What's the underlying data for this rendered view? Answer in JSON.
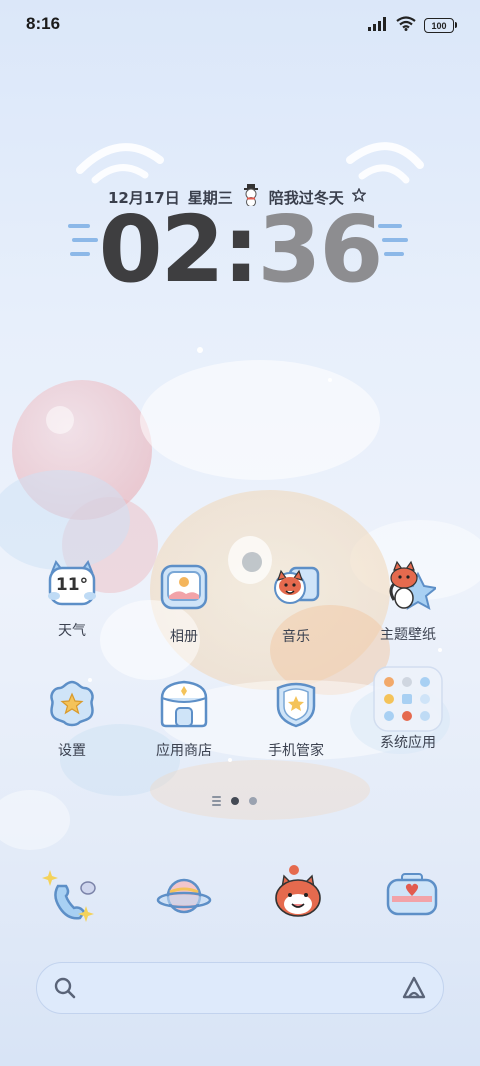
{
  "status_bar": {
    "time": "8:16",
    "signal_icon": "signal-bars-icon",
    "wifi_icon": "wifi-icon",
    "battery_level": "100"
  },
  "clock_widget": {
    "date": "12月17日",
    "weekday": "星期三",
    "slogan": "陪我过冬天",
    "hours": "02",
    "colon": ":",
    "minutes": "36"
  },
  "apps_row1": [
    {
      "label": "天气",
      "icon": "weather-cat-icon",
      "temp": "11°"
    },
    {
      "label": "相册",
      "icon": "gallery-icon"
    },
    {
      "label": "音乐",
      "icon": "music-icon"
    },
    {
      "label": "主题壁纸",
      "icon": "themes-icon"
    }
  ],
  "apps_row2": [
    {
      "label": "设置",
      "icon": "settings-flower-icon"
    },
    {
      "label": "应用商店",
      "icon": "app-store-icon"
    },
    {
      "label": "手机管家",
      "icon": "security-shield-icon"
    },
    {
      "label": "系统应用",
      "icon": "system-apps-folder-icon"
    }
  ],
  "page_indicator": {
    "pages": 2,
    "current": 1
  },
  "dock": [
    {
      "icon": "phone-icon"
    },
    {
      "icon": "messages-planet-icon"
    },
    {
      "icon": "browser-cat-icon"
    },
    {
      "icon": "camera-icon"
    }
  ],
  "search": {
    "search_icon": "search-icon",
    "assistant_icon": "assistant-icon"
  },
  "colors": {
    "accent_blue": "#7fb4e8",
    "label_text": "#3c4250",
    "clock_dark": "#3e3e40",
    "clock_light": "#8d8d90"
  }
}
